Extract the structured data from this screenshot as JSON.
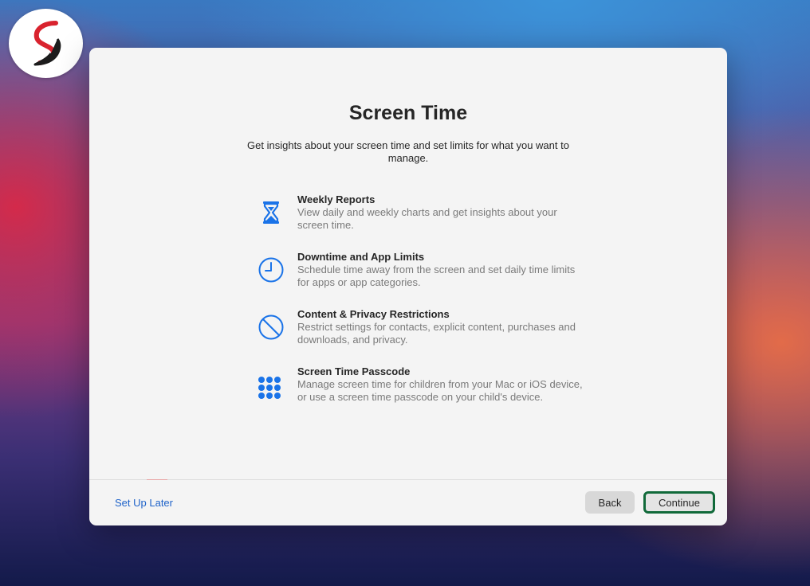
{
  "dialog": {
    "title": "Screen Time",
    "subtitle": "Get insights about your screen time and set limits for what you want to manage."
  },
  "features": [
    {
      "icon": "hourglass-icon",
      "title": "Weekly Reports",
      "description": "View daily and weekly charts and get insights about your screen time."
    },
    {
      "icon": "clock-icon",
      "title": "Downtime and App Limits",
      "description": "Schedule time away from the screen and set daily time limits for apps or app categories."
    },
    {
      "icon": "prohibited-icon",
      "title": "Content & Privacy Restrictions",
      "description": "Restrict settings for contacts, explicit content, purchases and downloads, and privacy."
    },
    {
      "icon": "keypad-icon",
      "title": "Screen Time Passcode",
      "description": "Manage screen time for children from your Mac or iOS device, or use a screen time passcode on your child's device."
    }
  ],
  "footer": {
    "setup_later_label": "Set Up Later",
    "back_label": "Back",
    "continue_label": "Continue"
  },
  "colors": {
    "accent_blue": "#1a73e8",
    "link_blue": "#1f63c9",
    "focus_ring": "#116a3a"
  }
}
